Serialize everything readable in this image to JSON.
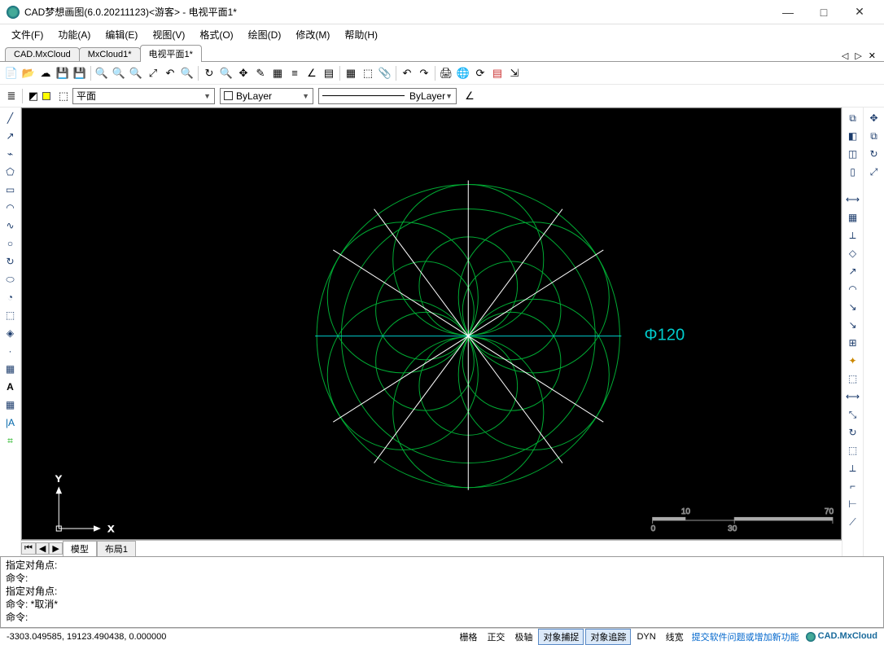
{
  "window": {
    "title": "CAD梦想画图(6.0.20211123)<游客> - 电视平面1*",
    "min": "—",
    "max": "□",
    "close": "✕"
  },
  "menu": {
    "items": [
      "文件(F)",
      "功能(A)",
      "编辑(E)",
      "视图(V)",
      "格式(O)",
      "绘图(D)",
      "修改(M)",
      "帮助(H)"
    ]
  },
  "doc_tabs": {
    "items": [
      "CAD.MxCloud",
      "MxCloud1*",
      "电视平面1*"
    ],
    "active": 2
  },
  "layer": {
    "current": "平面",
    "linetype": "ByLayer",
    "bylayer": "ByLayer"
  },
  "canvas": {
    "dim_label": "Φ120",
    "axis_x": "X",
    "axis_y": "Y",
    "ruler": {
      "t10": "10",
      "t70": "70",
      "b0": "0",
      "b30": "30"
    }
  },
  "model_tabs": {
    "model": "模型",
    "layout": "布局1"
  },
  "cmd": {
    "l1": "指定对角点:",
    "l2": "命令:",
    "l3": "指定对角点:",
    "l4": "命令:   *取消*",
    "l5": "命令:"
  },
  "status": {
    "coords": "-3303.049585,  19123.490438,  0.000000",
    "toggles": {
      "grid": "栅格",
      "ortho": "正交",
      "polar": "极轴",
      "osnap": "对象捕捉",
      "otrack": "对象追踪",
      "dyn": "DYN",
      "lwt": "线宽"
    },
    "on": [
      "osnap",
      "otrack"
    ],
    "feedback": "提交软件问题或增加新功能",
    "brand": "CAD.MxCloud"
  }
}
